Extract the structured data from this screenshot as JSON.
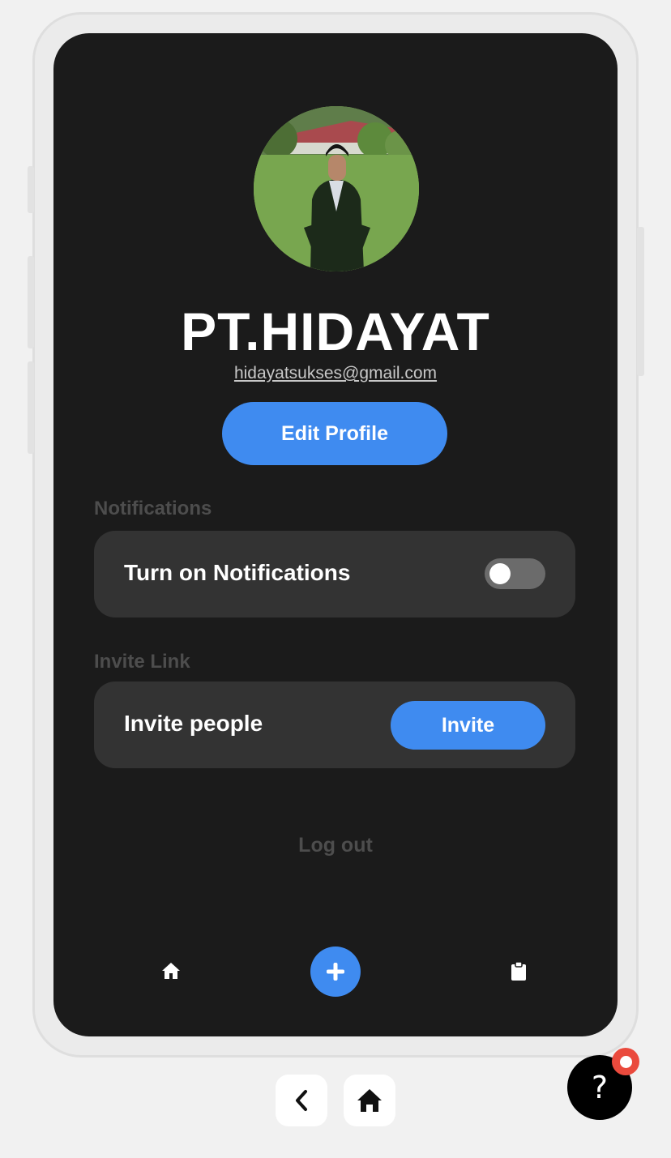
{
  "profile": {
    "name": "PT.HIDAYAT",
    "email": "hidayatsukses@gmail.com",
    "edit_label": "Edit Profile"
  },
  "notifications": {
    "section_label": "Notifications",
    "toggle_label": "Turn on Notifications",
    "enabled": false
  },
  "invite": {
    "section_label": "Invite Link",
    "label": "Invite people",
    "button_label": "Invite"
  },
  "logout_label": "Log out",
  "bottom_nav": {
    "items": [
      {
        "icon": "home-icon"
      },
      {
        "icon": "plus-icon"
      },
      {
        "icon": "clipboard-icon"
      }
    ]
  },
  "device_controls": {
    "back_icon": "chevron-left-icon",
    "home_icon": "home-icon"
  },
  "help": {
    "label": "?",
    "badge": true
  },
  "colors": {
    "accent": "#3f8bf0",
    "screen_bg": "#1b1b1b",
    "card_bg": "#333333",
    "badge": "#ea4a3d"
  }
}
